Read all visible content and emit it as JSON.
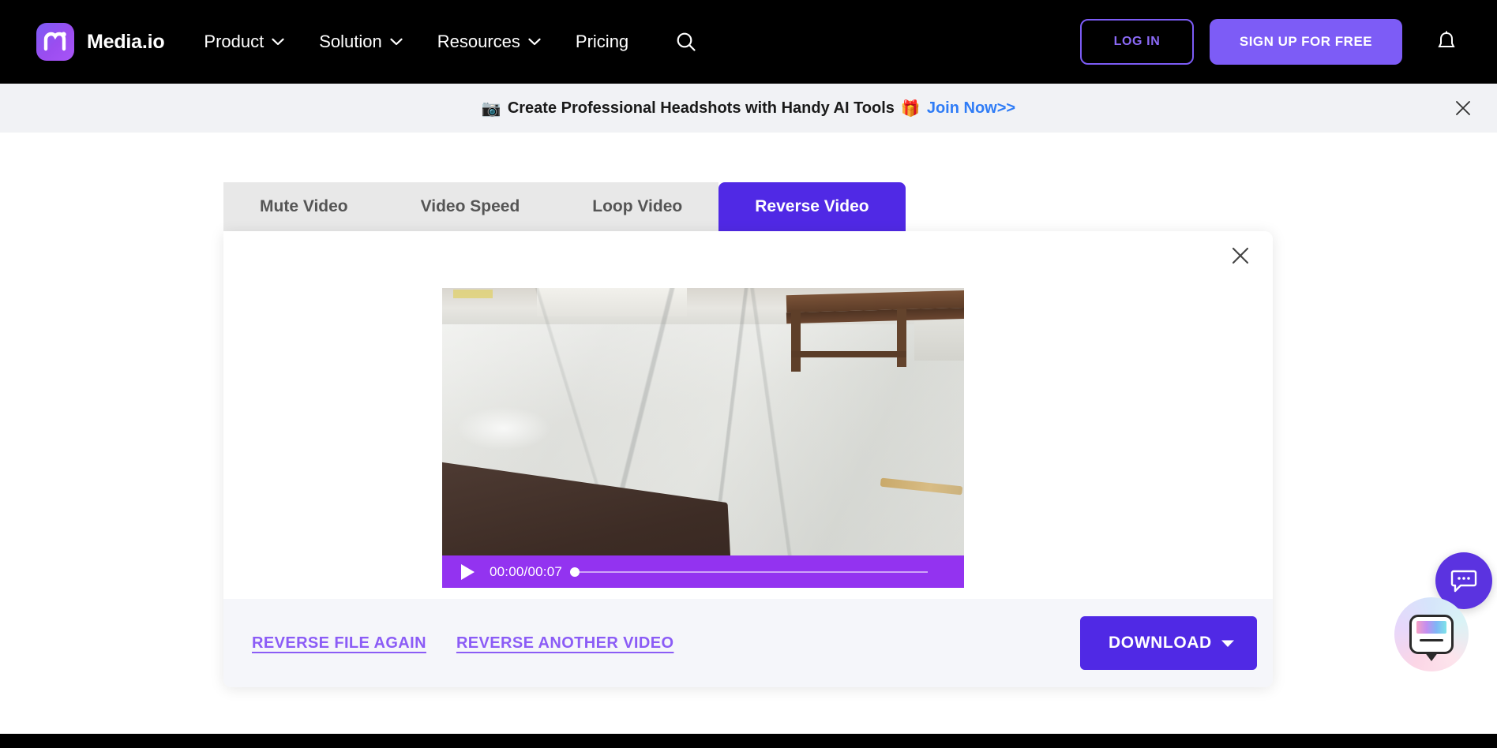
{
  "navbar": {
    "brand": {
      "name": "Media.io",
      "logo_icon": "media-io-logo",
      "accent": "#7c5cf5"
    },
    "links": [
      {
        "label": "Product",
        "has_caret": true
      },
      {
        "label": "Solution",
        "has_caret": true
      },
      {
        "label": "Resources",
        "has_caret": true
      },
      {
        "label": "Pricing",
        "has_caret": false
      }
    ],
    "search_icon": "search-icon",
    "login_label": "LOG IN",
    "signup_label": "SIGN UP FOR FREE",
    "bell_icon": "bell-icon",
    "background": "#000000"
  },
  "promo": {
    "camera_emoji": "📷",
    "text": "Create Professional Headshots with Handy AI Tools",
    "gift_emoji": "🎁",
    "link_label": "Join Now>>",
    "link_color": "#2f7cf6",
    "close_icon": "close-icon",
    "background": "#f1f2f5"
  },
  "tabs": [
    {
      "label": "Mute Video",
      "active": false
    },
    {
      "label": "Video Speed",
      "active": false
    },
    {
      "label": "Loop Video",
      "active": false
    },
    {
      "label": "Reverse Video",
      "active": true
    }
  ],
  "card": {
    "close_icon": "close-icon",
    "player": {
      "play_icon": "play-icon",
      "time": "00:00/00:07",
      "current_time": "00:00",
      "duration": "00:07",
      "progress_percent": 0,
      "controls_color": "#9333f0"
    },
    "footer": {
      "links": [
        {
          "label": "REVERSE FILE AGAIN"
        },
        {
          "label": "REVERSE ANOTHER VIDEO"
        }
      ],
      "download_label": "DOWNLOAD",
      "download_caret_icon": "chevron-down-icon",
      "download_color": "#5029e5",
      "background": "#f5f6fa"
    }
  },
  "floating": {
    "chat_icon": "chat-bubble-icon",
    "ai_assistant_icon": "ai-assistant-icon"
  },
  "theme": {
    "primary": "#5029e5",
    "secondary": "#7d5cf6",
    "link": "#8b5cf6",
    "player": "#9333f0"
  }
}
